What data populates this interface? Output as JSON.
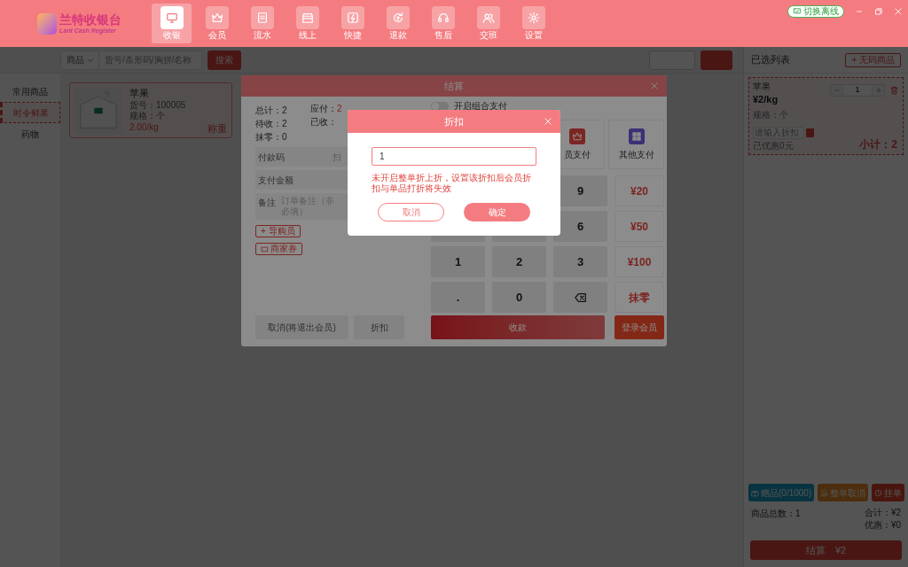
{
  "app": {
    "logo_title": "兰特收银台",
    "logo_subtitle": "Lant Cash Register",
    "offline_button": "切换离线"
  },
  "nav": [
    {
      "label": "收银",
      "selected": true,
      "kind": "monitor"
    },
    {
      "label": "会员",
      "selected": false,
      "kind": "crown"
    },
    {
      "label": "流水",
      "selected": false,
      "kind": "list"
    },
    {
      "label": "线上",
      "selected": false,
      "kind": "store"
    },
    {
      "label": "快捷",
      "selected": false,
      "kind": "bolt"
    },
    {
      "label": "退款",
      "selected": false,
      "kind": "refund"
    },
    {
      "label": "售后",
      "selected": false,
      "kind": "support"
    },
    {
      "label": "交班",
      "selected": false,
      "kind": "users"
    },
    {
      "label": "设置",
      "selected": false,
      "kind": "gear"
    }
  ],
  "search": {
    "category": "商品",
    "placeholder": "货号/条形码/胸拼/名称",
    "button": "搜索"
  },
  "categories": [
    {
      "label": "常用商品",
      "selected": false
    },
    {
      "label": "时令鲜果",
      "selected": true
    },
    {
      "label": "药物",
      "selected": false
    }
  ],
  "products": [
    {
      "name": "苹果",
      "code": "货号：100005",
      "spec": "规格：个",
      "price": "2.00/kg",
      "tag": "称重"
    }
  ],
  "cart": {
    "title": "已选列表",
    "add_button": "+ 无码商品",
    "items": [
      {
        "name": "苹果",
        "price": "¥2/kg",
        "spec": "规格：个",
        "quantity": "1",
        "discount_placeholder": "请输入折扣",
        "saved": "已优惠0元",
        "subtotal": "小计：2"
      }
    ],
    "actions": [
      {
        "label": "赠品(0/1000)",
        "kind": "gift"
      },
      {
        "label": "整单取消",
        "kind": "doc"
      },
      {
        "label": "挂单",
        "kind": "clock"
      }
    ],
    "total_count": "商品总数：1",
    "total": "合计：¥2",
    "discount": "优惠：¥0",
    "checkout_button": "结算　¥2"
  },
  "checkout": {
    "title": "结算",
    "summary": [
      {
        "label": "总计：",
        "value": "2"
      },
      {
        "label": "待收：",
        "value": "2"
      },
      {
        "label": "抹零：",
        "value": "0"
      }
    ],
    "summary_right": [
      {
        "label": "应付：",
        "value": "2"
      },
      {
        "label": "已收："
      }
    ],
    "payment_code": {
      "label": "付款码",
      "placeholder": "扫"
    },
    "pay_amount": {
      "label": "支付金额"
    },
    "note": {
      "label": "备注",
      "placeholder": "订单备注（非必填）"
    },
    "tag_buttons": [
      {
        "label": "+ 导购员",
        "kind": "plain"
      },
      {
        "label": "商家券",
        "kind": "coupon"
      }
    ],
    "cancel_button": "取消(将退出会员)",
    "discount_button": "折扣",
    "combo_pay": {
      "label": "开启组合支付",
      "on": false
    },
    "pay_methods": [
      {
        "label": "员支付",
        "kind": "vip"
      },
      {
        "label": "其他支付",
        "kind": "grid"
      }
    ],
    "keypad": [
      [
        {
          "label": "9"
        },
        {
          "label": "¥20",
          "kind": "amount"
        }
      ],
      [
        {
          "label": "6"
        },
        {
          "label": "¥50",
          "kind": "amount"
        }
      ],
      [
        {
          "label": "1"
        },
        {
          "label": "2"
        },
        {
          "label": "3"
        },
        {
          "label": "¥100",
          "kind": "amount"
        }
      ],
      [
        {
          "label": "."
        },
        {
          "label": "0"
        },
        {
          "kind": "backspace"
        },
        {
          "label": "抹零",
          "kind": "amount"
        }
      ]
    ],
    "collect_button": "收款",
    "member_button": "登录会员"
  },
  "dialog": {
    "title": "折扣",
    "value": "1",
    "warning": "未开启整单折上折，设置该折扣后会员折扣与单品打折将失效",
    "cancel": "取消",
    "confirm": "确定"
  }
}
